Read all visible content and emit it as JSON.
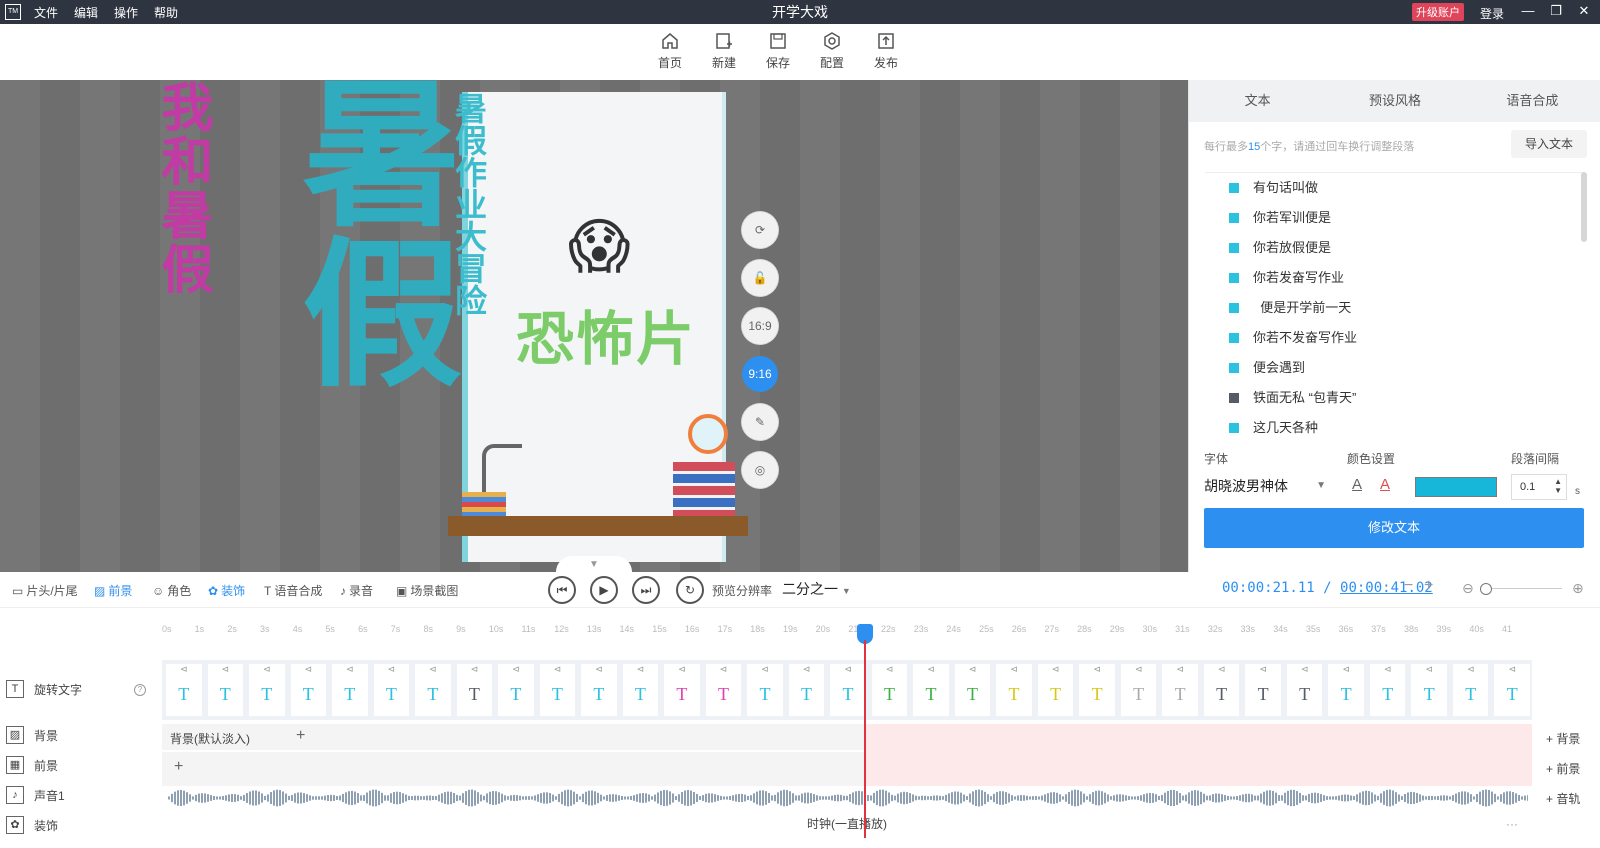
{
  "titlebar": {
    "logo": "TM",
    "menu": [
      "文件",
      "编辑",
      "操作",
      "帮助"
    ],
    "title": "开学大戏",
    "upgrade": "升级账户",
    "login": "登录",
    "min": "—",
    "restore": "❐",
    "close": "✕"
  },
  "toolbar": {
    "items": [
      {
        "label": "首页",
        "icon": "home-icon"
      },
      {
        "label": "新建",
        "icon": "new-icon"
      },
      {
        "label": "保存",
        "icon": "save-icon"
      },
      {
        "label": "配置",
        "icon": "settings-icon"
      },
      {
        "label": "发布",
        "icon": "publish-icon"
      }
    ]
  },
  "stage": {
    "bg_text_1": "我和暑假",
    "bg_text_2": "暑假",
    "phone_vertical_text": "暑假作业大冒险",
    "emoji": "😱",
    "headline": "恐怖片",
    "controls": [
      "⟳",
      "🔓",
      "16:9",
      "9:16",
      "✎",
      "◎"
    ],
    "collapse": "▼"
  },
  "panel": {
    "tabs": [
      "文本",
      "预设风格",
      "语音合成"
    ],
    "hint_prefix": "每行最多",
    "hint_num": "15",
    "hint_suffix": "个字，请通过回车换行调整段落",
    "import_label": "导入文本",
    "lines": [
      {
        "text": "有句话叫做",
        "color": "#2bc1e0"
      },
      {
        "text": "你若军训便是",
        "color": "#2bc1e0"
      },
      {
        "text": "你若放假便是",
        "color": "#2bc1e0"
      },
      {
        "text": "你若发奋写作业",
        "color": "#2bc1e0"
      },
      {
        "text": "  便是开学前一天",
        "color": "#2bc1e0"
      },
      {
        "text": "你若不发奋写作业",
        "color": "#2bc1e0"
      },
      {
        "text": "便会遇到",
        "color": "#2bc1e0"
      },
      {
        "text": "铁面无私 “包青天”",
        "color": "#555c66"
      },
      {
        "text": "这几天各种",
        "color": "#2bc1e0"
      }
    ],
    "font_label": "字体",
    "font_value": "胡晓波男神体",
    "color_label": "颜色设置",
    "color_swatch": "#16b7d9",
    "spacing_label": "段落间隔",
    "spacing_value": "0.1",
    "spacing_unit": "s",
    "modify_label": "修改文本"
  },
  "transport": {
    "tabs": [
      {
        "label": "片头/片尾",
        "icon": "▭"
      },
      {
        "label": "前景",
        "icon": "▨"
      },
      {
        "label": "角色",
        "icon": "☺"
      },
      {
        "label": "装饰",
        "icon": "✿"
      },
      {
        "label": "语音合成",
        "icon": "T"
      },
      {
        "label": "录音",
        "icon": "♪"
      },
      {
        "label": "场景截图",
        "icon": "▣"
      }
    ],
    "res_label": "预览分辨率",
    "res_value": "二分之一",
    "time_current": "00:00:21.11",
    "time_sep": " / ",
    "time_total": "00:00:41.02"
  },
  "ruler": [
    "0s",
    "1s",
    "2s",
    "3s",
    "4s",
    "5s",
    "6s",
    "7s",
    "8s",
    "9s",
    "10s",
    "11s",
    "12s",
    "13s",
    "14s",
    "15s",
    "16s",
    "17s",
    "18s",
    "19s",
    "20s",
    "21s",
    "22s",
    "23s",
    "24s",
    "25s",
    "26s",
    "27s",
    "28s",
    "29s",
    "30s",
    "31s",
    "32s",
    "33s",
    "34s",
    "35s",
    "36s",
    "37s",
    "38s",
    "39s",
    "40s",
    "41"
  ],
  "tracks": {
    "rotate_text": "旋转文字",
    "background": "背景",
    "bg_clip": "背景(默认淡入)",
    "foreground": "前景",
    "audio": "声音1",
    "decor": "装饰",
    "clock_clip": "时钟(一直播放)",
    "add_bg": "背景",
    "add_fg": "前景",
    "add_audio": "音轨"
  },
  "text_clips": [
    {
      "color": "#2bc1e0"
    },
    {
      "color": "#2bc1e0"
    },
    {
      "color": "#2bc1e0"
    },
    {
      "color": "#2bc1e0"
    },
    {
      "color": "#2bc1e0"
    },
    {
      "color": "#2bc1e0"
    },
    {
      "color": "#2bc1e0"
    },
    {
      "color": "#555c66"
    },
    {
      "color": "#2bc1e0"
    },
    {
      "color": "#2bc1e0"
    },
    {
      "color": "#2bc1e0"
    },
    {
      "color": "#2bc1e0"
    },
    {
      "color": "#e040b0"
    },
    {
      "color": "#e040b0"
    },
    {
      "color": "#2bc1e0"
    },
    {
      "color": "#2bc1e0"
    },
    {
      "color": "#2bc1e0"
    },
    {
      "color": "#3cb043"
    },
    {
      "color": "#3cb043"
    },
    {
      "color": "#3cb043"
    },
    {
      "color": "#d6c81a"
    },
    {
      "color": "#d6c81a"
    },
    {
      "color": "#d6c81a"
    },
    {
      "color": "#aaaaaa"
    },
    {
      "color": "#aaaaaa"
    },
    {
      "color": "#555c66"
    },
    {
      "color": "#555c66"
    },
    {
      "color": "#555c66"
    },
    {
      "color": "#2bc1e0"
    },
    {
      "color": "#2bc1e0"
    },
    {
      "color": "#2bc1e0"
    },
    {
      "color": "#2bc1e0"
    },
    {
      "color": "#2bc1e0"
    }
  ],
  "clip_glyph": "T",
  "clip_mini": "⊲"
}
